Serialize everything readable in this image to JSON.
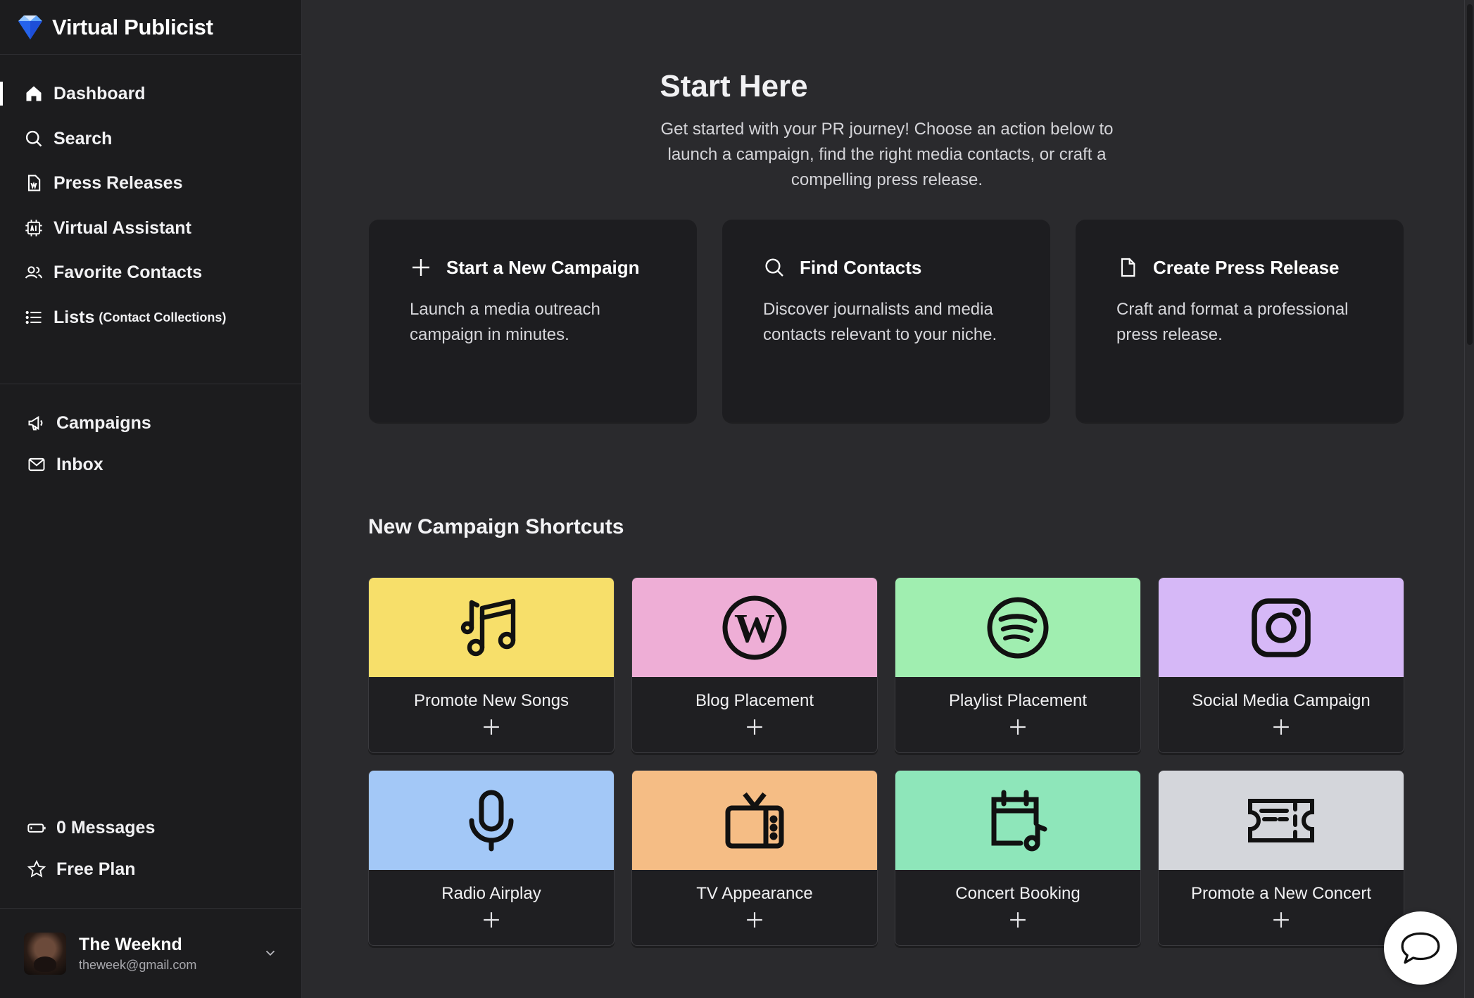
{
  "brand": {
    "name": "Virtual Publicist"
  },
  "nav": {
    "primary": [
      {
        "label": "Dashboard",
        "icon": "home-icon"
      },
      {
        "label": "Search",
        "icon": "search-icon"
      },
      {
        "label": "Press Releases",
        "icon": "document-icon"
      },
      {
        "label": "Virtual Assistant",
        "icon": "ai-chip-icon"
      },
      {
        "label": "Favorite Contacts",
        "icon": "users-icon"
      },
      {
        "label": "Lists",
        "sub": "(Contact Collections)",
        "icon": "list-icon"
      }
    ],
    "secondary": [
      {
        "label": "Campaigns",
        "icon": "megaphone-icon"
      },
      {
        "label": "Inbox",
        "icon": "mail-icon"
      }
    ],
    "bottom": [
      {
        "label": "0 Messages",
        "icon": "battery-icon"
      },
      {
        "label": "Free Plan",
        "icon": "star-icon"
      }
    ]
  },
  "user": {
    "name": "The Weeknd",
    "email": "theweek@gmail.com"
  },
  "start": {
    "title": "Start Here",
    "subtitle": "Get started with your PR journey! Choose an action below to launch a campaign, find the right media contacts, or craft a compelling press release.",
    "cards": [
      {
        "title": "Start a New Campaign",
        "desc": "Launch a media outreach campaign in minutes.",
        "icon": "plus-icon"
      },
      {
        "title": "Find Contacts",
        "desc": "Discover journalists and media contacts relevant to your niche.",
        "icon": "search-icon"
      },
      {
        "title": "Create Press Release",
        "desc": "Craft and format a professional press release.",
        "icon": "file-icon"
      }
    ]
  },
  "shortcuts": {
    "title": "New Campaign Shortcuts",
    "items": [
      {
        "label": "Promote New Songs",
        "color": "#f7df6a",
        "icon": "music-notes-icon"
      },
      {
        "label": "Blog Placement",
        "color": "#eeaed6",
        "icon": "wordpress-icon"
      },
      {
        "label": "Playlist Placement",
        "color": "#a0eeb0",
        "icon": "spotify-icon"
      },
      {
        "label": "Social Media Campaign",
        "color": "#d6b8f7",
        "icon": "instagram-icon"
      },
      {
        "label": "Radio Airplay",
        "color": "#a3c8f7",
        "icon": "microphone-icon"
      },
      {
        "label": "TV Appearance",
        "color": "#f5bd85",
        "icon": "tv-icon"
      },
      {
        "label": "Concert Booking",
        "color": "#8ee6ba",
        "icon": "calendar-music-icon"
      },
      {
        "label": "Promote a New Concert",
        "color": "#d4d6db",
        "icon": "ticket-icon"
      }
    ]
  }
}
